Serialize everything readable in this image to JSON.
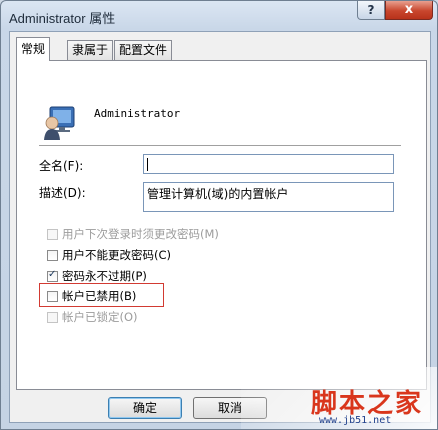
{
  "window": {
    "title": "Administrator 属性"
  },
  "titlebar": {
    "help_label": "?",
    "close_label": "x"
  },
  "tabs": [
    {
      "label": "常规",
      "active": true
    },
    {
      "label": "隶属于",
      "active": false
    },
    {
      "label": "配置文件",
      "active": false
    }
  ],
  "general": {
    "username": "Administrator",
    "fullname_label": "全名(F):",
    "fullname_value": "",
    "description_label": "描述(D):",
    "description_value": "管理计算机(域)的内置帐户"
  },
  "options": [
    {
      "label": "用户下次登录时须更改密码(M)",
      "checked": false,
      "disabled": true
    },
    {
      "label": "用户不能更改密码(C)",
      "checked": false,
      "disabled": false
    },
    {
      "label": "密码永不过期(P)",
      "checked": true,
      "disabled": false
    },
    {
      "label": "帐户已禁用(B)",
      "checked": false,
      "disabled": false
    },
    {
      "label": "帐户已锁定(O)",
      "checked": false,
      "disabled": true
    }
  ],
  "footer": {
    "ok_label": "确定",
    "cancel_label": "取消"
  },
  "watermark": {
    "brand": "脚本之家",
    "url": "www.jb51.net"
  },
  "colors": {
    "highlight": "#d23a32",
    "close_button": "#c8462d"
  }
}
